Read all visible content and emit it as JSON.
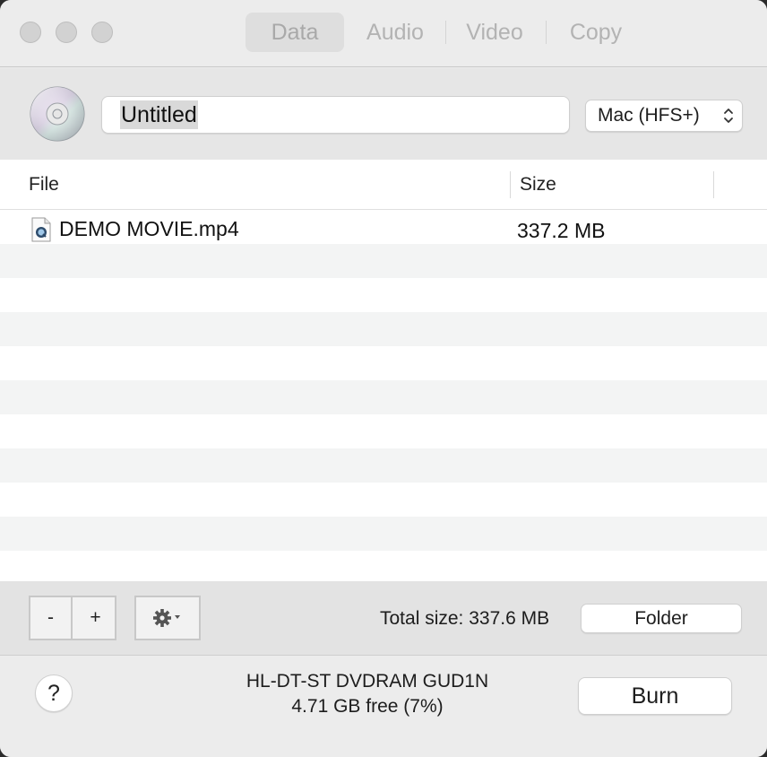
{
  "tabs": [
    {
      "label": "Data",
      "active": true
    },
    {
      "label": "Audio",
      "active": false
    },
    {
      "label": "Video",
      "active": false
    },
    {
      "label": "Copy",
      "active": false
    }
  ],
  "disc": {
    "icon": "cd-disc-icon",
    "name_value": "Untitled",
    "filesystem_selected": "Mac (HFS+)"
  },
  "table": {
    "columns": [
      "File",
      "Size"
    ],
    "rows": [
      {
        "icon": "video-file-icon",
        "name": "DEMO MOVIE.mp4",
        "size": "337.2 MB"
      }
    ]
  },
  "toolbar": {
    "remove_label": "-",
    "add_label": "+",
    "action_icon": "gear-icon",
    "total_size": "Total size: 337.6 MB",
    "folder_label": "Folder"
  },
  "footer": {
    "help_label": "?",
    "drive_name": "HL-DT-ST DVDRAM GUD1N",
    "drive_free": "4.71 GB free (7%)",
    "burn_label": "Burn"
  },
  "colors": {
    "window_bg": "#ececec",
    "row_alt": "#f3f4f4",
    "tab_active_bg": "#dedede"
  }
}
